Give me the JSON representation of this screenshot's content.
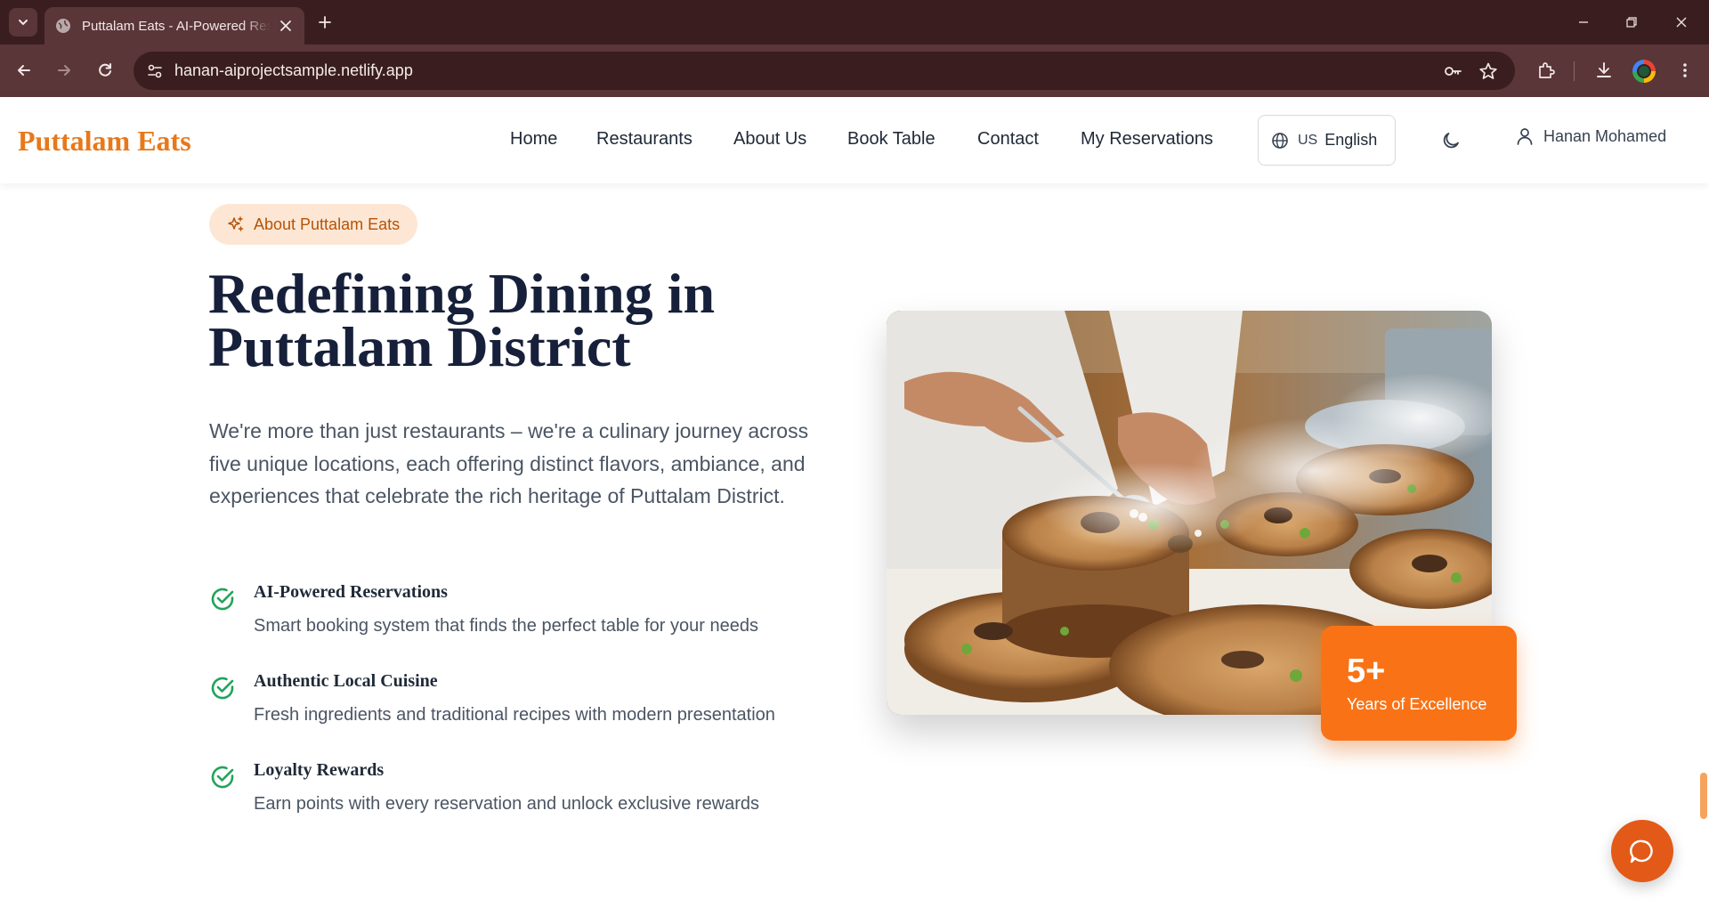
{
  "browser": {
    "tab_title": "Puttalam Eats - AI-Powered Restaurant Reservations",
    "url": "hanan-aiprojectsample.netlify.app"
  },
  "header": {
    "logo": "Puttalam Eats",
    "nav": [
      "Home",
      "Restaurants",
      "About Us",
      "Book Table",
      "Contact",
      "My Reservations"
    ],
    "language": {
      "flag": "US",
      "label": "English"
    },
    "user_name": "Hanan Mohamed"
  },
  "about": {
    "badge": "About Puttalam Eats",
    "headline_line1": "Redefining Dining in",
    "headline_line2": "Puttalam District",
    "lead": "We're more than just restaurants – we're a culinary journey across five unique locations, each offering distinct flavors, ambiance, and experiences that celebrate the rich heritage of Puttalam District.",
    "features": [
      {
        "title": "AI-Powered Reservations",
        "description": "Smart booking system that finds the perfect table for your needs"
      },
      {
        "title": "Authentic Local Cuisine",
        "description": "Fresh ingredients and traditional recipes with modern presentation"
      },
      {
        "title": "Loyalty Rewards",
        "description": "Earn points with every reservation and unlock exclusive rewards"
      }
    ],
    "stat": {
      "value": "5+",
      "label": "Years of Excellence"
    }
  },
  "colors": {
    "brand": "#e8781a",
    "accent": "#f97316",
    "check": "#22a35a",
    "heading": "#17203a",
    "chrome_dark": "#3a1e1f",
    "chrome_bar": "#5a3638"
  }
}
